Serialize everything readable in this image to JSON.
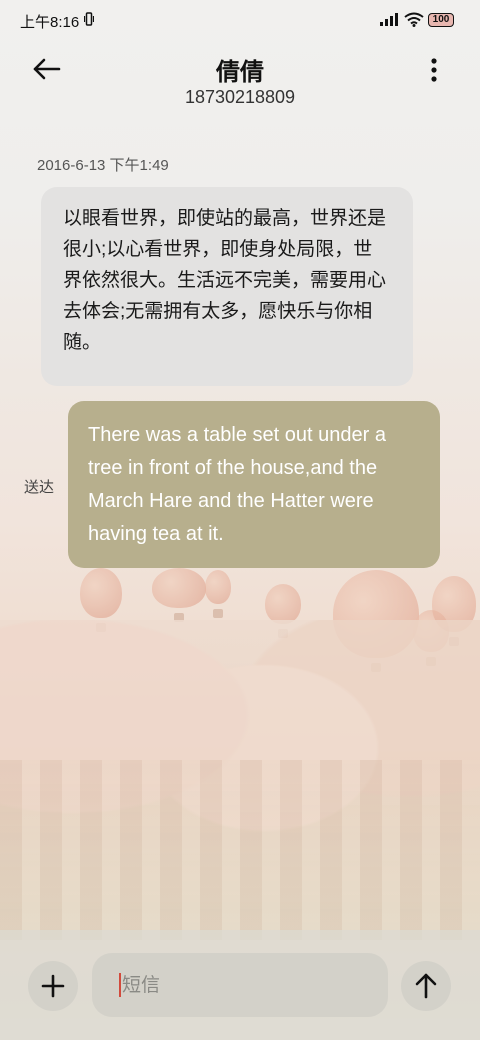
{
  "status_bar": {
    "time": "上午8:16",
    "battery": "100",
    "icons": [
      "vibrate-icon",
      "signal-icon",
      "wifi-icon",
      "battery-icon"
    ]
  },
  "header": {
    "title": "倩倩",
    "subtitle": "18730218809",
    "back_icon": "arrow-left-icon",
    "more_icon": "more-vertical-icon"
  },
  "messages": {
    "timestamp": "2016-6-13 下午1:49",
    "received": {
      "text": "以眼看世界，即使站的最高，世界还是很小;以心看世界，即使身处局限，世界依然很大。生活远不完美，需要用心去体会;无需拥有太多，愿快乐与你相随。"
    },
    "sent": {
      "status": "送达",
      "text": "There was a table set out under a tree in front of the house,and the March Hare and the Hatter were having tea at it."
    }
  },
  "composer": {
    "placeholder": "短信",
    "value": "",
    "add_icon": "plus-icon",
    "send_icon": "arrow-up-icon"
  },
  "colors": {
    "sent_bubble": "#b7af8d",
    "received_bubble": "#e3e2e1",
    "caret": "#d24a3c"
  }
}
